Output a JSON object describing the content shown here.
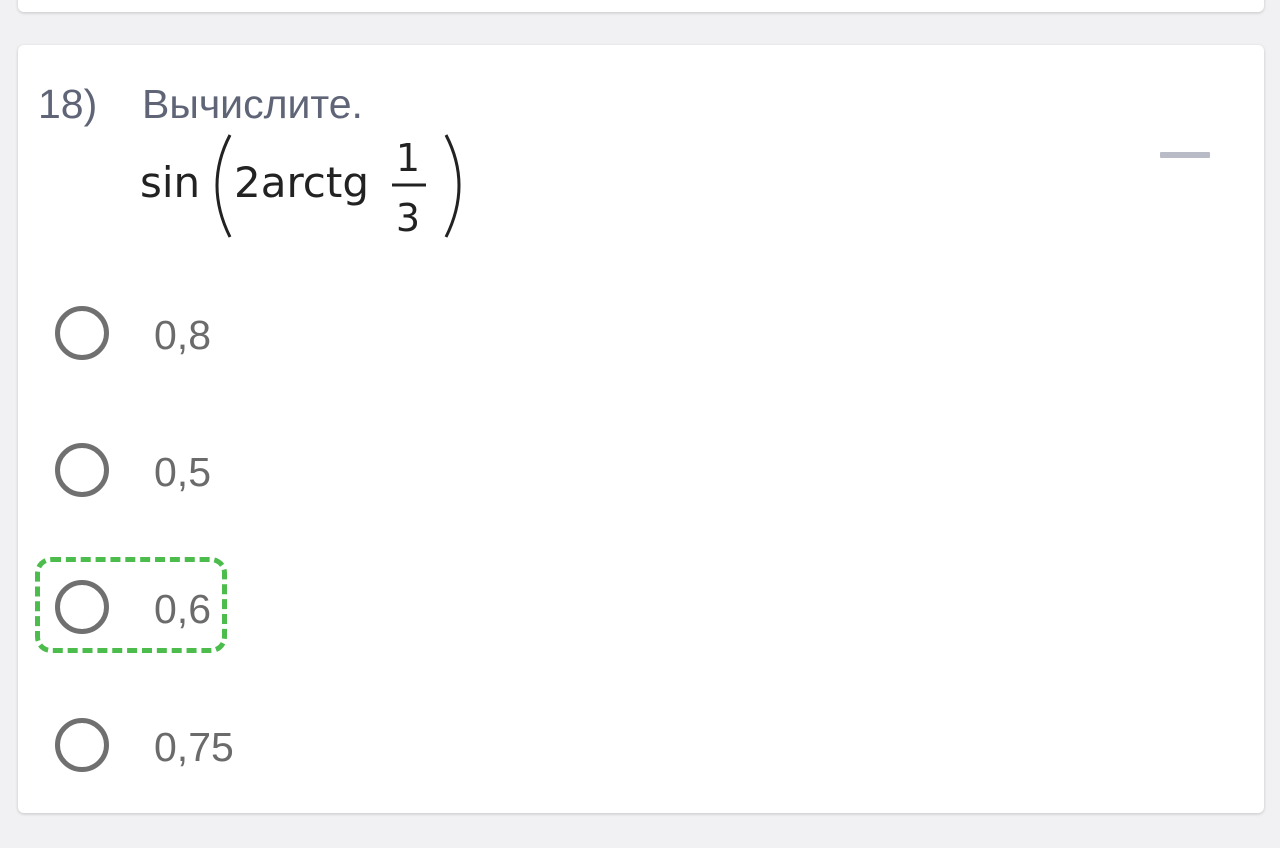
{
  "question": {
    "number": "18)",
    "title": "Вычислите.",
    "formula": {
      "func": "sin",
      "coefficient_func": "2arctg",
      "numerator": "1",
      "denominator": "3"
    }
  },
  "options": [
    {
      "label": "0,8"
    },
    {
      "label": "0,5"
    },
    {
      "label": "0,6"
    },
    {
      "label": "0,75"
    }
  ],
  "colors": {
    "highlight": "#4cbc4c",
    "title_text": "#5f6577",
    "option_text": "#6b6b6b",
    "radio_border": "#707070"
  },
  "icons": {
    "collapse": "minus-icon",
    "option_marker": "radio-circle-icon"
  }
}
